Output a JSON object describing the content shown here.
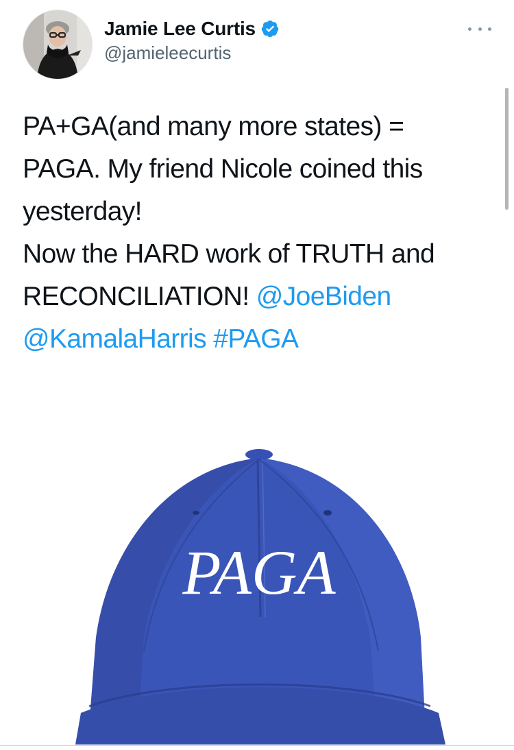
{
  "author": {
    "name": "Jamie Lee Curtis",
    "handle": "@jamieleecurtis",
    "verified": true
  },
  "tweet": {
    "lines": [
      [
        {
          "text": "PA+GA(and many more states) =",
          "type": "text"
        }
      ],
      [
        {
          "text": "PAGA. My friend Nicole coined this",
          "type": "text"
        }
      ],
      [
        {
          "text": "yesterday!",
          "type": "text"
        }
      ],
      [
        {
          "text": "Now the HARD work of TRUTH and",
          "type": "text"
        }
      ],
      [
        {
          "text": "RECONCILIATION! ",
          "type": "text"
        },
        {
          "text": "@JoeBiden",
          "type": "mention"
        }
      ],
      [
        {
          "text": "@KamalaHarris",
          "type": "mention"
        },
        {
          "text": " ",
          "type": "text"
        },
        {
          "text": "#PAGA",
          "type": "hashtag"
        }
      ]
    ]
  },
  "media": {
    "hat_text": "PAGA",
    "hat_color": "#3a55b8"
  },
  "icons": {
    "verified": "verified-badge-icon",
    "more": "more-options-icon"
  },
  "colors": {
    "link": "#1d9bf0",
    "text": "#0f1419",
    "secondary": "#536471",
    "verified": "#1d9bf0"
  }
}
